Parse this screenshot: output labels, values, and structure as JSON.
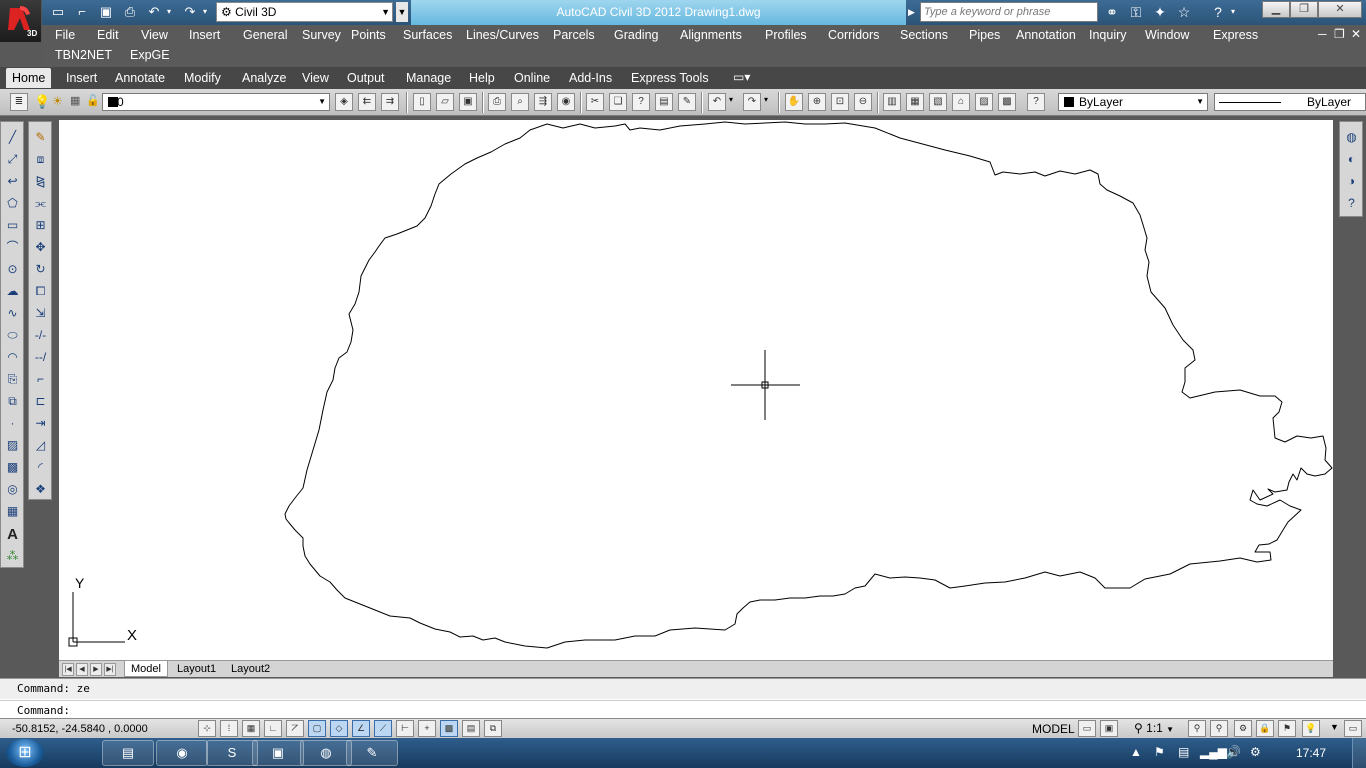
{
  "window": {
    "title": "AutoCAD Civil 3D 2012  Drawing1.dwg",
    "app_badge": "3D",
    "workspace": "Civil 3D",
    "search_placeholder": "Type a keyword or phrase",
    "min_icon": "minimize-icon",
    "max_icon": "restore-icon",
    "close_icon": "close-icon"
  },
  "menubar": {
    "row1": [
      "File",
      "Edit",
      "View",
      "Insert",
      "General",
      "Survey",
      "Points",
      "Surfaces",
      "Lines/Curves",
      "Parcels",
      "Grading",
      "Alignments",
      "Profiles",
      "Corridors",
      "Sections",
      "Pipes",
      "Annotation",
      "Inquiry",
      "Window",
      "Express"
    ],
    "row2": [
      "TBN2NET",
      "ExpGE"
    ]
  },
  "ribbon_tabs": [
    "Home",
    "Insert",
    "Annotate",
    "Modify",
    "Analyze",
    "View",
    "Output",
    "Manage",
    "Help",
    "Online",
    "Add-Ins",
    "Express Tools"
  ],
  "active_tab": "Home",
  "toolbar": {
    "layer": "0",
    "color": "ByLayer",
    "linetype": "ByLayer"
  },
  "layout_tabs": [
    "Model",
    "Layout1",
    "Layout2"
  ],
  "active_layout": "Model",
  "ucs": {
    "x_label": "X",
    "y_label": "Y"
  },
  "command": {
    "history": "Command: ze",
    "prompt": "Command:"
  },
  "status": {
    "coordinates": "-50.8152,  -24.5840  , 0.0000",
    "model": "MODEL",
    "annotation_scale": "1:1"
  },
  "taskbar": {
    "time": "17:47"
  },
  "colors": {
    "title_bar": "#3c6b96",
    "menu_bar": "#5a5a5a",
    "canvas": "#ffffff",
    "taskbar": "#1f4a74"
  }
}
